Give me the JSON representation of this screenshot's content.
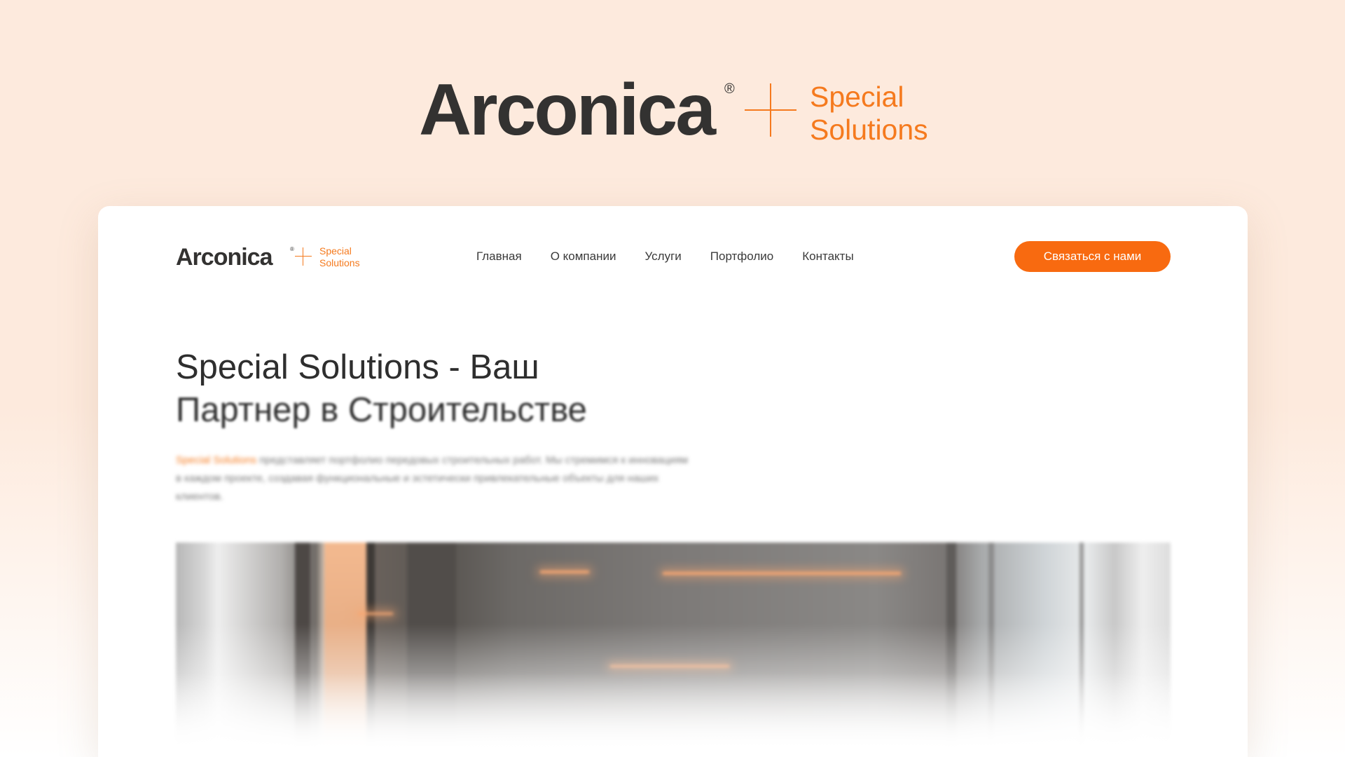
{
  "brand": {
    "name": "Arconica",
    "registered": "®",
    "tagline_line1": "Special",
    "tagline_line2": "Solutions"
  },
  "header": {
    "logo": {
      "name": "Arconica",
      "registered": "®",
      "tagline_line1": "Special",
      "tagline_line2": "Solutions"
    },
    "nav": [
      {
        "label": "Главная"
      },
      {
        "label": "О компании"
      },
      {
        "label": "Услуги"
      },
      {
        "label": "Портфолио"
      },
      {
        "label": "Контакты"
      }
    ],
    "cta_label": "Связаться с нами"
  },
  "hero": {
    "title_line1": "Special Solutions - Ваш",
    "title_line2": "Партнер в Строительстве",
    "description_accent": "Special Solutions",
    "description_rest": " представляет портфолио передовых строительных работ. Мы стремимся к инновациям в каждом проекте, создавая функциональные и эстетически привлекательные объекты для наших клиентов."
  },
  "colors": {
    "accent": "#f57a1e",
    "cta_background": "#f86a10",
    "page_background": "#fdeadd",
    "text_dark": "#333231"
  }
}
